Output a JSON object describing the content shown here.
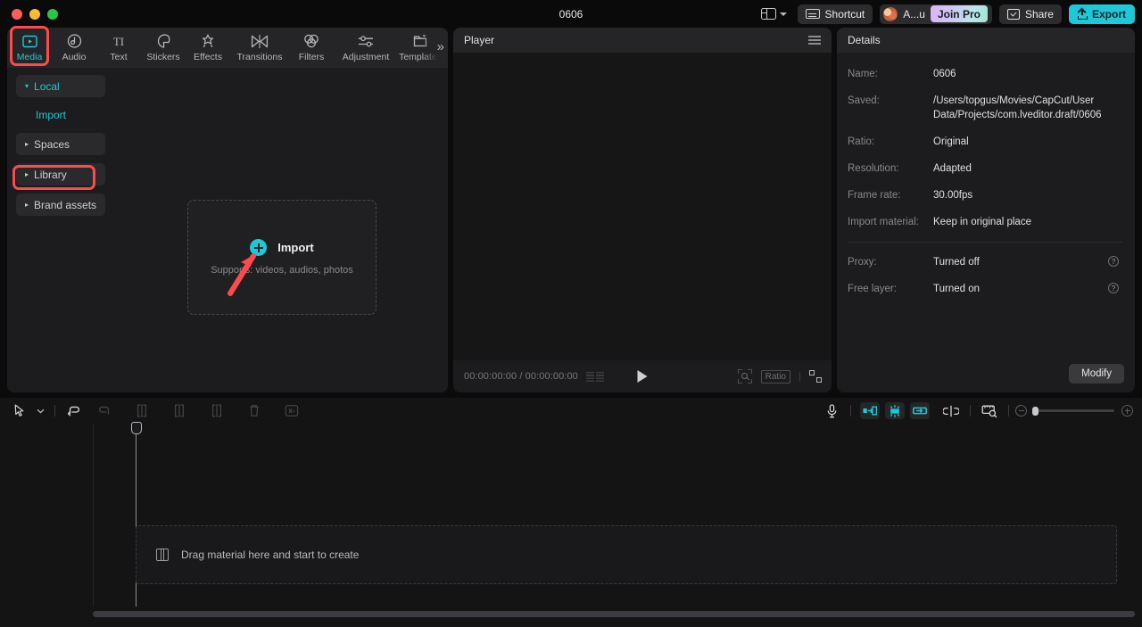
{
  "titlebar": {
    "project_title": "0606",
    "layout_icon": "layout-icon",
    "shortcut_label": "Shortcut",
    "account_name": "A...u",
    "join_pro_label": "Join Pro",
    "share_label": "Share",
    "export_label": "Export"
  },
  "nav_tabs": [
    {
      "label": "Media",
      "icon": "media-icon",
      "active": true
    },
    {
      "label": "Audio",
      "icon": "audio-icon",
      "active": false
    },
    {
      "label": "Text",
      "icon": "text-icon",
      "active": false
    },
    {
      "label": "Stickers",
      "icon": "stickers-icon",
      "active": false
    },
    {
      "label": "Effects",
      "icon": "effects-icon",
      "active": false
    },
    {
      "label": "Transitions",
      "icon": "transitions-icon",
      "active": false
    },
    {
      "label": "Filters",
      "icon": "filters-icon",
      "active": false
    },
    {
      "label": "Adjustment",
      "icon": "adjustment-icon",
      "active": false
    },
    {
      "label": "Templates",
      "icon": "templates-icon",
      "active": false
    }
  ],
  "nav_overflow": "»",
  "sidebar": {
    "items": [
      {
        "label": "Local",
        "expanded": true,
        "arrow": "▾"
      },
      {
        "label": "Import",
        "sub": true
      },
      {
        "label": "Spaces",
        "expanded": false,
        "arrow": "▸"
      },
      {
        "label": "Library",
        "expanded": false,
        "arrow": "▸",
        "highlighted": true
      },
      {
        "label": "Brand assets",
        "expanded": false,
        "arrow": "▸"
      }
    ]
  },
  "import_box": {
    "label": "Import",
    "supports": "Supports: videos, audios, photos",
    "plus_icon": "plus-circle-icon"
  },
  "player": {
    "title": "Player",
    "menu_icon": "hamburger-icon",
    "current_time": "00:00:00:00",
    "total_time": "00:00:00:00",
    "timecode": "00:00:00:00 / 00:00:00:00",
    "play_icon": "play-icon",
    "zoom_icon": "zoom-fit-icon",
    "ratio_label": "Ratio",
    "fullscreen_icon": "fullscreen-icon"
  },
  "details": {
    "title": "Details",
    "rows": [
      {
        "key": "Name:",
        "value": "0606"
      },
      {
        "key": "Saved:",
        "value": "/Users/topgus/Movies/CapCut/User Data/Projects/com.lveditor.draft/0606"
      },
      {
        "key": "Ratio:",
        "value": "Original"
      },
      {
        "key": "Resolution:",
        "value": "Adapted"
      },
      {
        "key": "Frame rate:",
        "value": "30.00fps"
      },
      {
        "key": "Import material:",
        "value": "Keep in original place"
      }
    ],
    "toggle_rows": [
      {
        "key": "Proxy:",
        "value": "Turned off",
        "help": "?"
      },
      {
        "key": "Free layer:",
        "value": "Turned on",
        "help": "?"
      }
    ],
    "modify_label": "Modify"
  },
  "timeline": {
    "tools_left": [
      {
        "icon": "select-arrow-icon",
        "dim": false
      },
      {
        "icon": "chevron-down-icon",
        "dim": false
      },
      {
        "icon": "undo-icon",
        "dim": false
      },
      {
        "icon": "redo-icon",
        "dim": true
      },
      {
        "icon": "split-icon",
        "dim": true
      },
      {
        "icon": "trim-left-icon",
        "dim": true
      },
      {
        "icon": "trim-right-icon",
        "dim": true
      },
      {
        "icon": "delete-icon",
        "dim": true
      },
      {
        "icon": "mute-icon",
        "dim": true
      }
    ],
    "tools_right": [
      {
        "icon": "microphone-icon",
        "dim": false
      },
      {
        "icon": "auto-caption-icon",
        "dim": false
      },
      {
        "icon": "auto-highlight-icon",
        "dim": false
      },
      {
        "icon": "retouch-icon",
        "dim": false
      },
      {
        "icon": "keyframe-icon",
        "dim": false
      },
      {
        "icon": "snap-ruler-icon",
        "dim": false
      }
    ],
    "zoom_out_icon": "zoom-out-icon",
    "zoom_in_icon": "zoom-in-icon",
    "dropzone_text": "Drag material here and start to create",
    "dropzone_icon": "film-strip-icon"
  },
  "colors": {
    "accent": "#1ec8d6",
    "annotation": "#fb4b4b",
    "panel_bg": "#1c1c1e",
    "header_bg": "#252527",
    "app_bg": "#0b0b0c"
  }
}
